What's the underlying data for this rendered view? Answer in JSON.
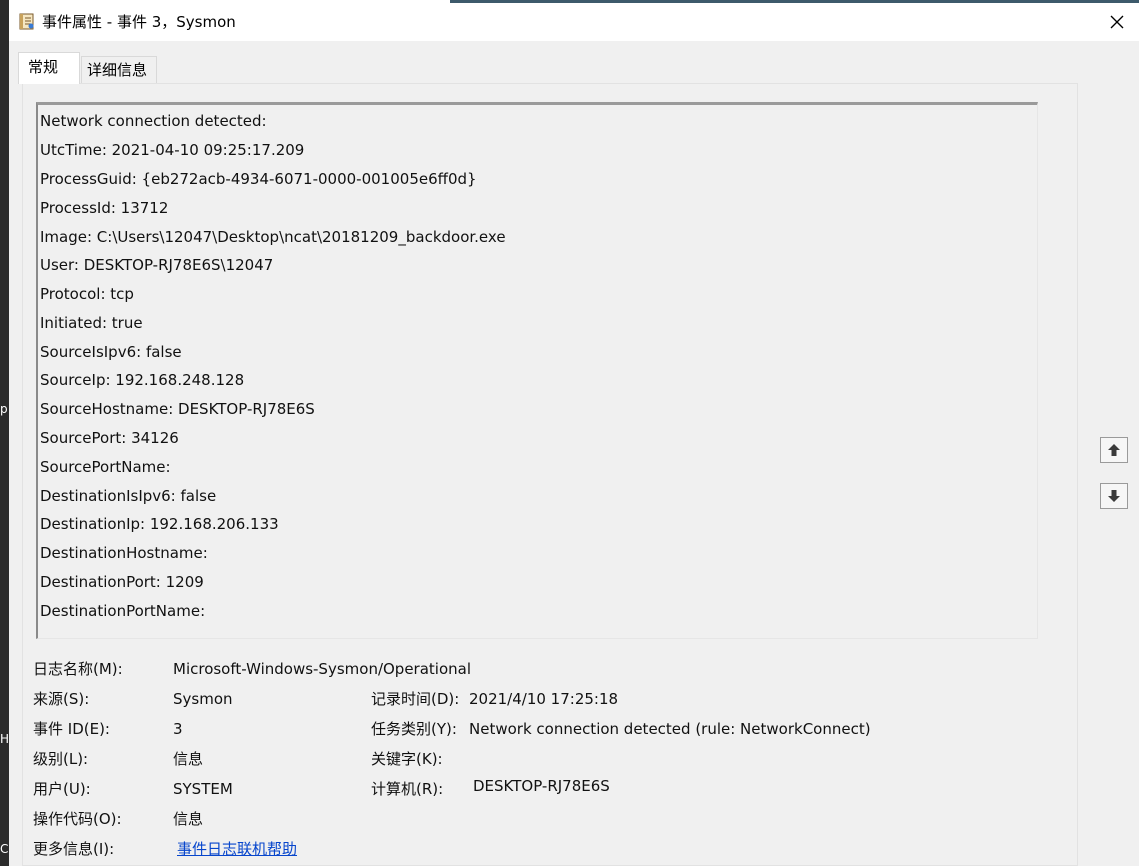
{
  "window": {
    "title": "事件属性 - 事件 3，Sysmon"
  },
  "tabs": [
    {
      "label": "常规"
    },
    {
      "label": "详细信息"
    }
  ],
  "description_lines": [
    "Network connection detected:",
    "UtcTime: 2021-04-10 09:25:17.209",
    "ProcessGuid: {eb272acb-4934-6071-0000-001005e6ff0d}",
    "ProcessId: 13712",
    "Image: C:\\Users\\12047\\Desktop\\ncat\\20181209_backdoor.exe",
    "User: DESKTOP-RJ78E6S\\12047",
    "Protocol: tcp",
    "Initiated: true",
    "SourceIsIpv6: false",
    "SourceIp: 192.168.248.128",
    "SourceHostname: DESKTOP-RJ78E6S",
    "SourcePort: 34126",
    "SourcePortName:",
    "DestinationIsIpv6: false",
    "DestinationIp: 192.168.206.133",
    "DestinationHostname:",
    "DestinationPort: 1209",
    "DestinationPortName:"
  ],
  "fields": {
    "log_name": {
      "label": "日志名称(M):",
      "value": "Microsoft-Windows-Sysmon/Operational"
    },
    "source": {
      "label": "来源(S):",
      "value": "Sysmon"
    },
    "logged": {
      "label": "记录时间(D):",
      "value": "2021/4/10 17:25:18"
    },
    "event_id": {
      "label": "事件 ID(E):",
      "value": "3"
    },
    "task_category": {
      "label": "任务类别(Y):",
      "value": "Network connection detected (rule: NetworkConnect)"
    },
    "level": {
      "label": "级别(L):",
      "value": "信息"
    },
    "keywords": {
      "label": "关键字(K):",
      "value": ""
    },
    "user": {
      "label": "用户(U):",
      "value": "SYSTEM"
    },
    "computer": {
      "label": "计算机(R):",
      "value": "DESKTOP-RJ78E6S"
    },
    "opcode": {
      "label": "操作代码(O):",
      "value": "信息"
    },
    "more_info": {
      "label": "更多信息(I):",
      "value": "事件日志联机帮助"
    }
  },
  "background_fragments": {
    "frag1": "p",
    "frag2": "H",
    "frag3": "C"
  },
  "icons": {
    "app": "event-properties-icon",
    "close": "close-icon",
    "up": "arrow-up-icon",
    "down": "arrow-down-icon"
  }
}
